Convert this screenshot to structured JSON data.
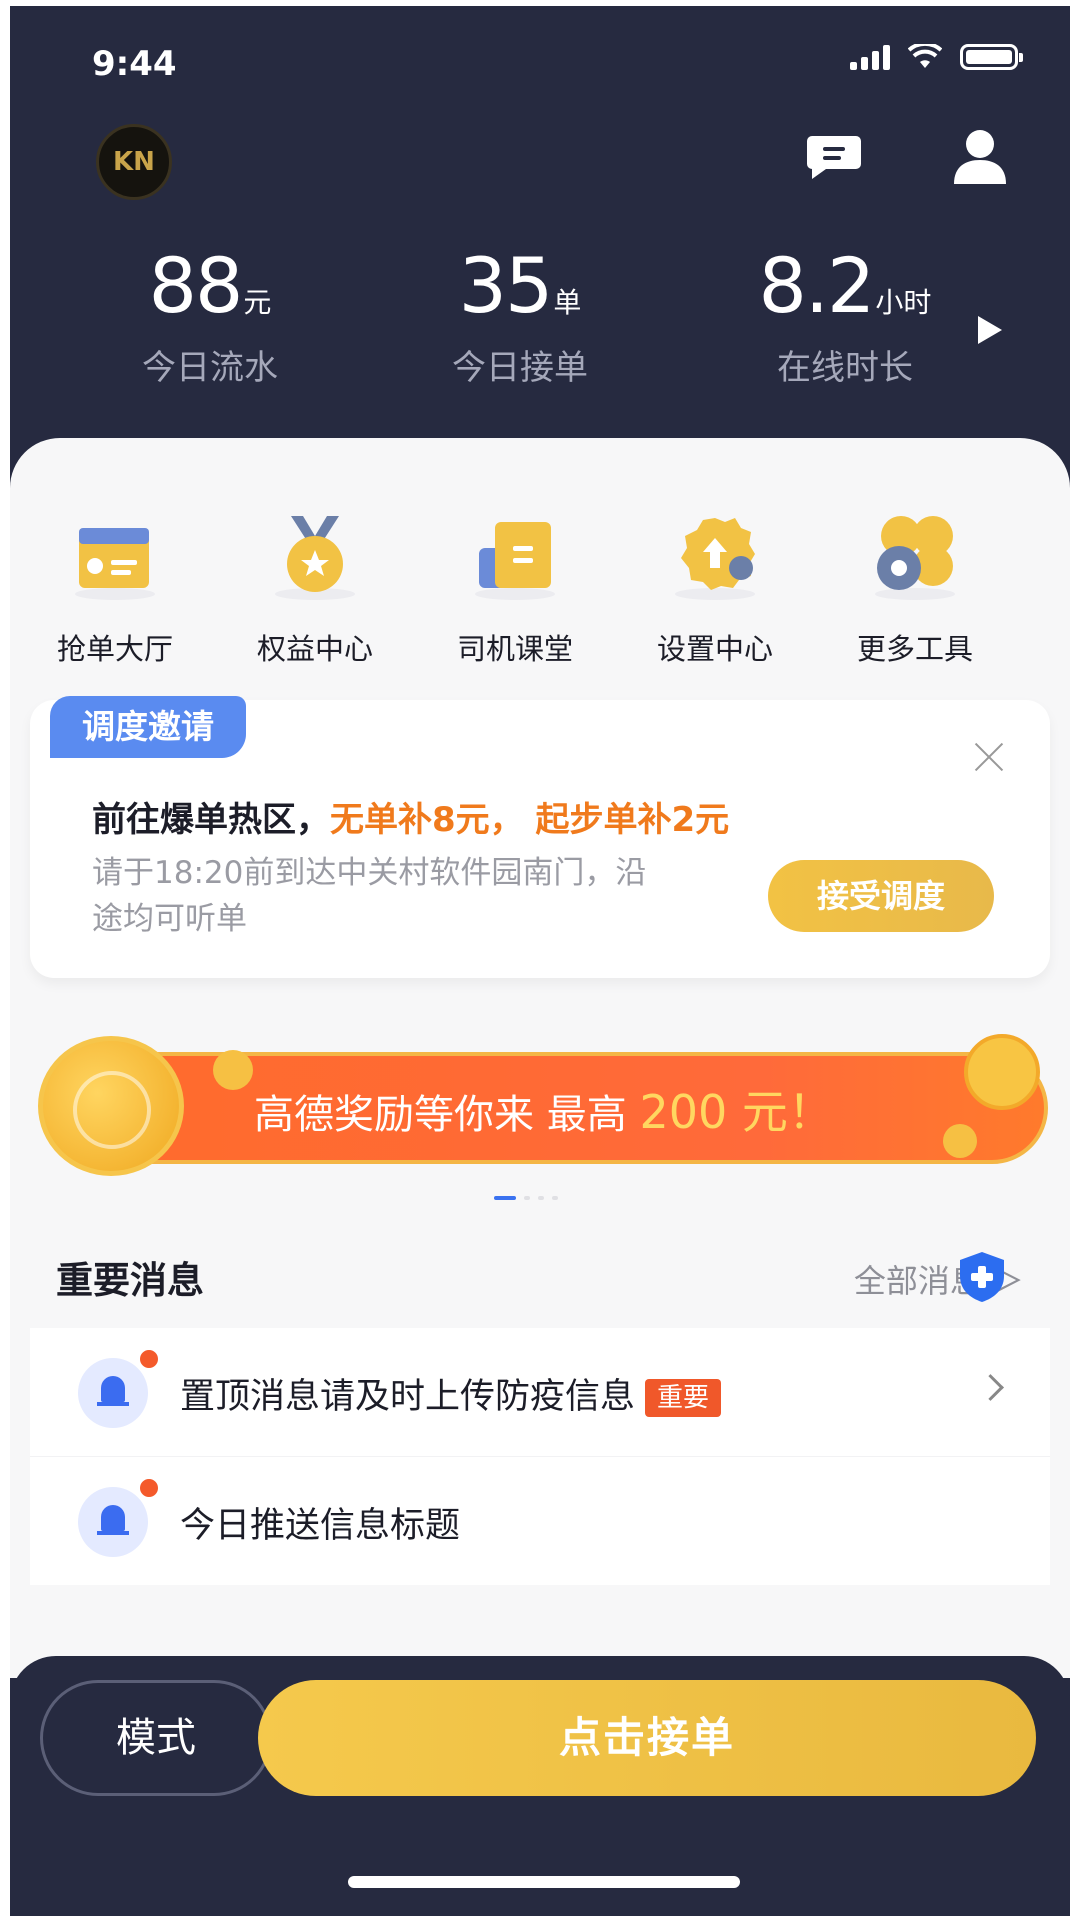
{
  "status": {
    "time": "9:44"
  },
  "avatar": {
    "initials": "KN"
  },
  "stats": [
    {
      "value": "88",
      "unit": "元",
      "label": "今日流水"
    },
    {
      "value": "35",
      "unit": "单",
      "label": "今日接单"
    },
    {
      "value": "8.2",
      "unit": "小时",
      "label": "在线时长"
    }
  ],
  "menu": [
    {
      "label": "抢单大厅",
      "icon": "order-hall-icon"
    },
    {
      "label": "权益中心",
      "icon": "medal-icon"
    },
    {
      "label": "司机课堂",
      "icon": "book-icon"
    },
    {
      "label": "设置中心",
      "icon": "gear-icon"
    },
    {
      "label": "更多工具",
      "icon": "tools-icon"
    }
  ],
  "dispatch": {
    "tag": "调度邀请",
    "title_prefix": "前往爆单热区，",
    "title_highlight": "无单补8元，  起步单补2元",
    "desc": "请于18:20前到达中关村软件园南门，沿途均可听单",
    "accept": "接受调度"
  },
  "banner": {
    "text": "高德奖励等你来 最高 ",
    "amount": "200 元！"
  },
  "messages": {
    "heading": "重要消息",
    "all": "全部消息 ＞",
    "items": [
      {
        "text": "置顶消息请及时上传防疫信息",
        "tag": "重要"
      },
      {
        "text": "今日推送信息标题",
        "tag": ""
      }
    ]
  },
  "bottom": {
    "mode": "模式",
    "take": "点击接单"
  },
  "colors": {
    "navy": "#262a40",
    "gold": "#f2c244",
    "orange": "#ff6b2c",
    "blue": "#3b6cf0"
  }
}
